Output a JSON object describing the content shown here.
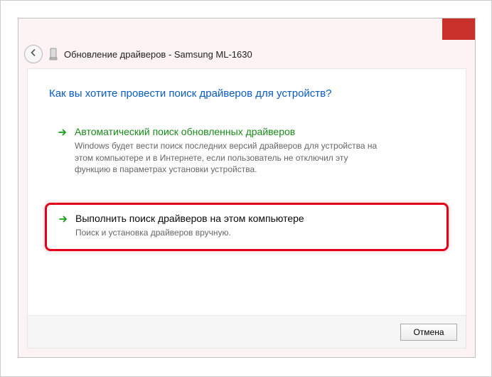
{
  "window": {
    "title": "Обновление драйверов - Samsung ML-1630"
  },
  "heading": "Как вы хотите провести поиск драйверов для устройств?",
  "options": [
    {
      "title": "Автоматический поиск обновленных драйверов",
      "desc": "Windows будет вести поиск последних версий драйверов для устройства на этом компьютере и в Интернете, если пользователь не отключил эту функцию в параметрах установки устройства."
    },
    {
      "title": "Выполнить поиск драйверов на этом компьютере",
      "desc": "Поиск и установка драйверов вручную."
    }
  ],
  "buttons": {
    "cancel": "Отмена"
  }
}
